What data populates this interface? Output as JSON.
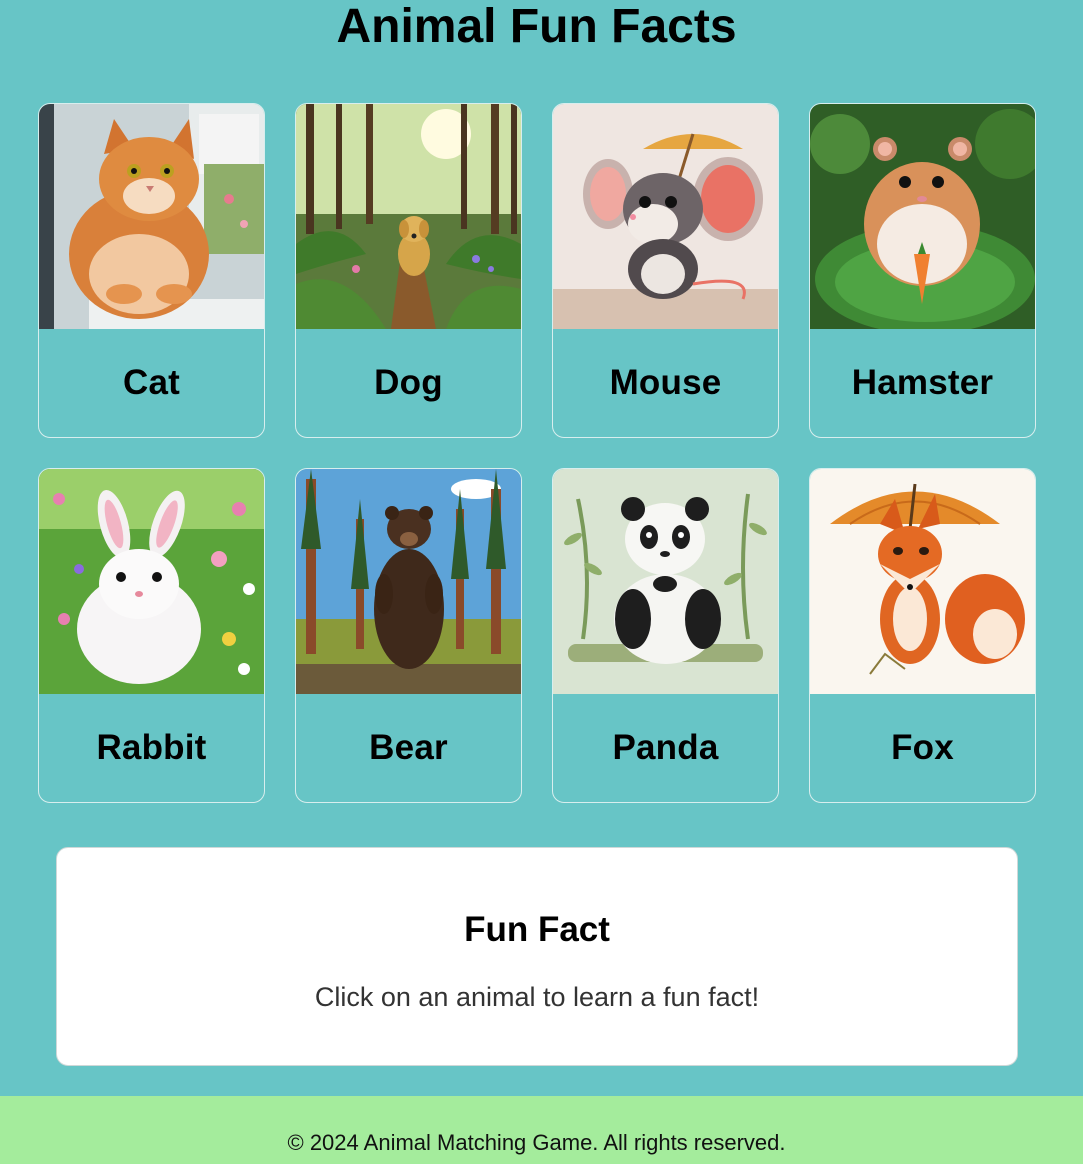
{
  "page_title": "Animal Fun Facts",
  "animals": [
    {
      "name": "Cat",
      "image_icon": "cat-image"
    },
    {
      "name": "Dog",
      "image_icon": "dog-image"
    },
    {
      "name": "Mouse",
      "image_icon": "mouse-image"
    },
    {
      "name": "Hamster",
      "image_icon": "hamster-image"
    },
    {
      "name": "Rabbit",
      "image_icon": "rabbit-image"
    },
    {
      "name": "Bear",
      "image_icon": "bear-image"
    },
    {
      "name": "Panda",
      "image_icon": "panda-image"
    },
    {
      "name": "Fox",
      "image_icon": "fox-image"
    }
  ],
  "fact_panel": {
    "title": "Fun Fact",
    "text": "Click on an animal to learn a fun fact!"
  },
  "footer": {
    "text": "© 2024 Animal Matching Game. All rights reserved."
  },
  "colors": {
    "background": "#67c5c6",
    "footer": "#a4ec9c",
    "panel": "#ffffff"
  }
}
